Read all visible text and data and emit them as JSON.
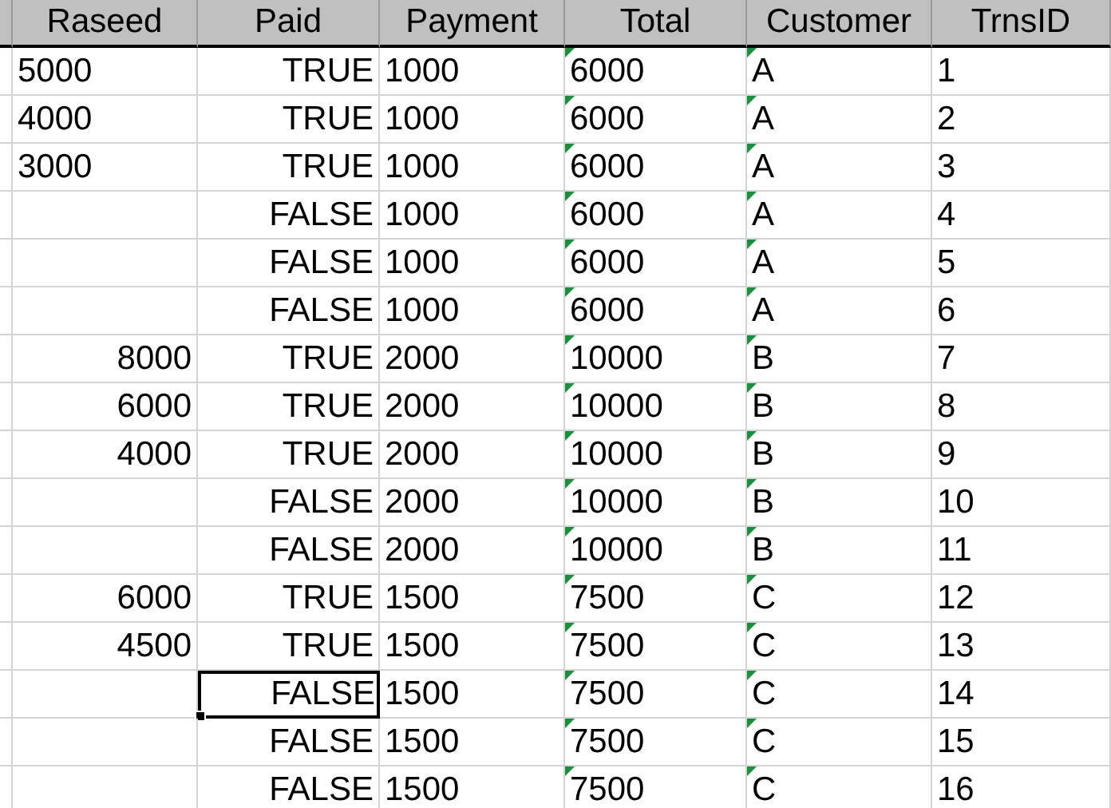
{
  "columns": [
    {
      "label": "Raseed",
      "kind": "text",
      "flagged": false
    },
    {
      "label": "Paid",
      "kind": "boolean",
      "flagged": false
    },
    {
      "label": "Payment",
      "kind": "text",
      "flagged": false
    },
    {
      "label": "Total",
      "kind": "text",
      "flagged": true
    },
    {
      "label": "Customer",
      "kind": "text",
      "flagged": true
    },
    {
      "label": "TrnsID",
      "kind": "text",
      "flagged": false
    }
  ],
  "rows": [
    {
      "cells": [
        {
          "text": "5000",
          "kind": "text"
        },
        "TRUE",
        "1000",
        "6000",
        "A",
        "1"
      ],
      "paid_selected": false
    },
    {
      "cells": [
        {
          "text": "4000",
          "kind": "text"
        },
        "TRUE",
        "1000",
        "6000",
        "A",
        "2"
      ],
      "paid_selected": false
    },
    {
      "cells": [
        {
          "text": "3000",
          "kind": "text"
        },
        "TRUE",
        "1000",
        "6000",
        "A",
        "3"
      ],
      "paid_selected": false
    },
    {
      "cells": [
        null,
        "FALSE",
        "1000",
        "6000",
        "A",
        "4"
      ],
      "paid_selected": false
    },
    {
      "cells": [
        null,
        "FALSE",
        "1000",
        "6000",
        "A",
        "5"
      ],
      "paid_selected": false
    },
    {
      "cells": [
        null,
        "FALSE",
        "1000",
        "6000",
        "A",
        "6"
      ],
      "paid_selected": false
    },
    {
      "cells": [
        {
          "text": "8000",
          "kind": "number"
        },
        "TRUE",
        "2000",
        "10000",
        "B",
        "7"
      ],
      "paid_selected": false
    },
    {
      "cells": [
        {
          "text": "6000",
          "kind": "number"
        },
        "TRUE",
        "2000",
        "10000",
        "B",
        "8"
      ],
      "paid_selected": false
    },
    {
      "cells": [
        {
          "text": "4000",
          "kind": "number"
        },
        "TRUE",
        "2000",
        "10000",
        "B",
        "9"
      ],
      "paid_selected": false
    },
    {
      "cells": [
        null,
        "FALSE",
        "2000",
        "10000",
        "B",
        "10"
      ],
      "paid_selected": false
    },
    {
      "cells": [
        null,
        "FALSE",
        "2000",
        "10000",
        "B",
        "11"
      ],
      "paid_selected": false
    },
    {
      "cells": [
        {
          "text": "6000",
          "kind": "number"
        },
        "TRUE",
        "1500",
        "7500",
        "C",
        "12"
      ],
      "paid_selected": false
    },
    {
      "cells": [
        {
          "text": "4500",
          "kind": "number"
        },
        "TRUE",
        "1500",
        "7500",
        "C",
        "13"
      ],
      "paid_selected": false
    },
    {
      "cells": [
        null,
        "FALSE",
        "1500",
        "7500",
        "C",
        "14"
      ],
      "paid_selected": true
    },
    {
      "cells": [
        null,
        "FALSE",
        "1500",
        "7500",
        "C",
        "15"
      ],
      "paid_selected": false
    },
    {
      "cells": [
        null,
        "FALSE",
        "1500",
        "7500",
        "C",
        "16"
      ],
      "paid_selected": false
    }
  ]
}
